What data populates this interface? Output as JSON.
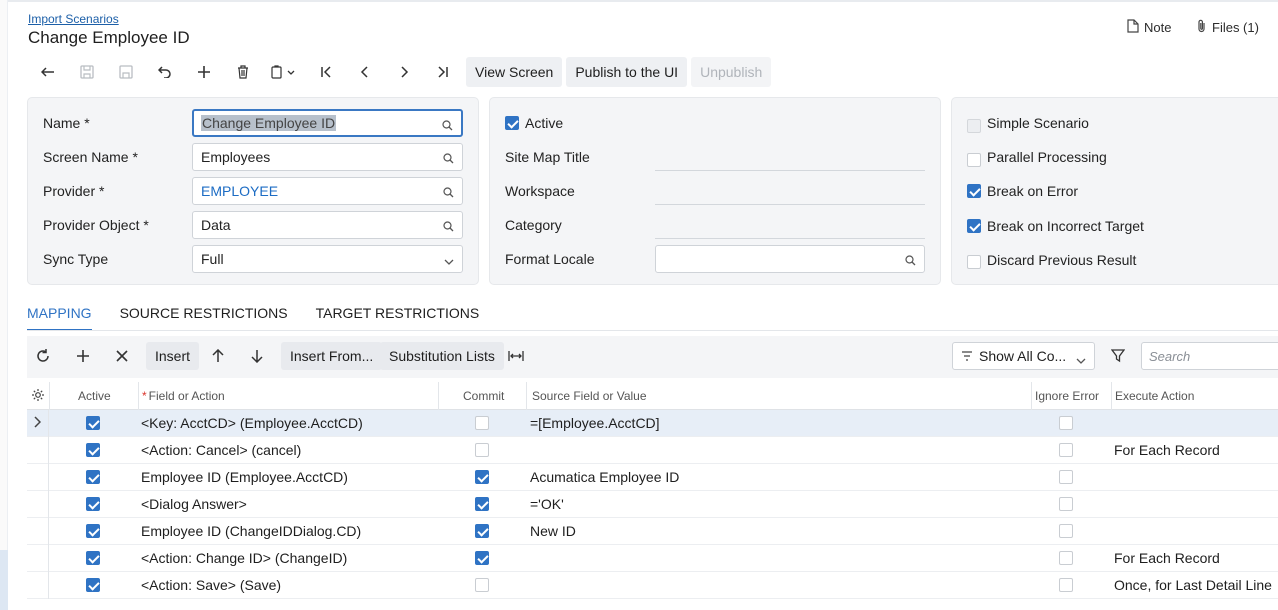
{
  "breadcrumb": "Import Scenarios",
  "title": "Change Employee ID",
  "header_actions": {
    "note": "Note",
    "files": "Files (1)"
  },
  "toolbar": {
    "icons": [
      "back-arrow-icon",
      "save-close-icon",
      "save-icon",
      "undo-icon",
      "add-icon",
      "delete-icon",
      "copy-paste-icon",
      "first-record-icon",
      "prev-record-icon",
      "next-record-icon",
      "last-record-icon"
    ],
    "view_screen": "View Screen",
    "publish": "Publish to the UI",
    "unpublish": "Unpublish"
  },
  "form": {
    "name": {
      "label": "Name",
      "value": "Change Employee ID",
      "required": true
    },
    "screen_name": {
      "label": "Screen Name",
      "value": "Employees",
      "required": true
    },
    "provider": {
      "label": "Provider",
      "value": "EMPLOYEE",
      "required": true
    },
    "provider_object": {
      "label": "Provider Object",
      "value": "Data",
      "required": true
    },
    "sync_type": {
      "label": "Sync Type",
      "value": "Full"
    },
    "active": {
      "label": "Active",
      "checked": true
    },
    "site_map_title": {
      "label": "Site Map Title",
      "value": ""
    },
    "workspace": {
      "label": "Workspace",
      "value": ""
    },
    "category": {
      "label": "Category",
      "value": ""
    },
    "format_locale": {
      "label": "Format Locale",
      "value": ""
    },
    "simple_scenario": {
      "label": "Simple Scenario",
      "checked": false,
      "disabled": true
    },
    "parallel_processing": {
      "label": "Parallel Processing",
      "checked": false
    },
    "break_on_error": {
      "label": "Break on Error",
      "checked": true
    },
    "break_on_incorrect_target": {
      "label": "Break on Incorrect Target",
      "checked": true
    },
    "discard_previous_result": {
      "label": "Discard Previous Result",
      "checked": false
    }
  },
  "tabs": [
    "MAPPING",
    "SOURCE RESTRICTIONS",
    "TARGET RESTRICTIONS"
  ],
  "active_tab": "MAPPING",
  "grid_toolbar": {
    "insert": "Insert",
    "insert_from": "Insert From...",
    "substitution_lists": "Substitution Lists",
    "show_all": "Show All Co...",
    "search_placeholder": "Search"
  },
  "grid": {
    "columns": [
      "Active",
      "Field or Action",
      "Commit",
      "Source Field or Value",
      "Ignore Error",
      "Execute Action"
    ],
    "rows": [
      {
        "active": true,
        "field": "<Key: AcctCD> (Employee.AcctCD)",
        "commit": false,
        "source": "=[Employee.AcctCD]",
        "ignore_error": false,
        "execute": ""
      },
      {
        "active": true,
        "field": "<Action: Cancel> (cancel)",
        "commit": false,
        "source": "",
        "ignore_error": false,
        "execute": "For Each Record"
      },
      {
        "active": true,
        "field": "Employee ID (Employee.AcctCD)",
        "commit": true,
        "source": "Acumatica Employee ID",
        "ignore_error": false,
        "execute": ""
      },
      {
        "active": true,
        "field": "<Dialog Answer>",
        "commit": true,
        "source": "='OK'",
        "ignore_error": false,
        "execute": ""
      },
      {
        "active": true,
        "field": "Employee ID (ChangeIDDialog.CD)",
        "commit": true,
        "source": "New ID",
        "ignore_error": false,
        "execute": ""
      },
      {
        "active": true,
        "field": "<Action: Change ID> (ChangeID)",
        "commit": true,
        "source": "",
        "ignore_error": false,
        "execute": "For Each Record"
      },
      {
        "active": true,
        "field": "<Action: Save> (Save)",
        "commit": false,
        "source": "",
        "ignore_error": false,
        "execute": "Once, for Last Detail Line"
      }
    ]
  },
  "colors": {
    "accent": "#2f73c4",
    "panel_bg": "#f4f5f7",
    "link": "#1c5fa8"
  }
}
